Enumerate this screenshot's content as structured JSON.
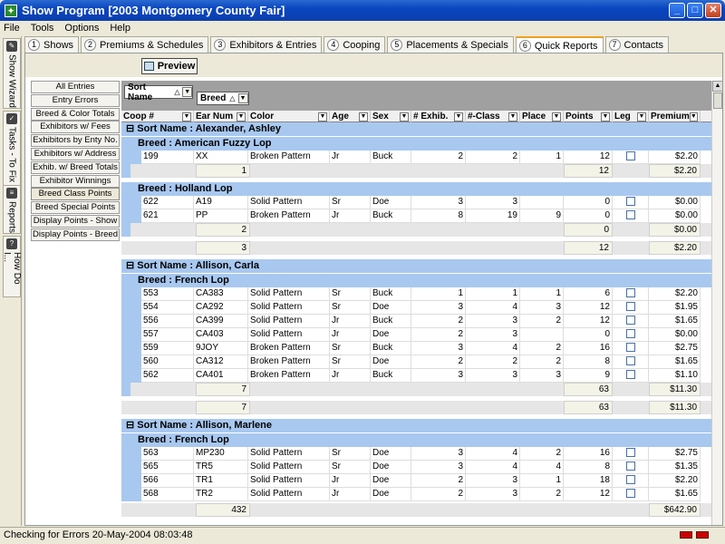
{
  "window": {
    "title": "Show Program [2003 Montgomery County Fair]"
  },
  "menu": [
    "File",
    "Tools",
    "Options",
    "Help"
  ],
  "side_tabs": [
    "Show Wizard",
    "Tasks - To Fix",
    "Reports",
    "How Do I..."
  ],
  "tabs": [
    {
      "num": "1",
      "label": "Shows"
    },
    {
      "num": "2",
      "label": "Premiums & Schedules"
    },
    {
      "num": "3",
      "label": "Exhibitors & Entries"
    },
    {
      "num": "4",
      "label": "Cooping"
    },
    {
      "num": "5",
      "label": "Placements & Specials"
    },
    {
      "num": "6",
      "label": "Quick Reports"
    },
    {
      "num": "7",
      "label": "Contacts"
    }
  ],
  "toolbar": {
    "preview_label": "Preview"
  },
  "reports": [
    "All Entries",
    "Entry Errors",
    "Breed & Color Totals",
    "Exhibitors w/ Fees",
    "Exhibitors by Enty No.",
    "Exhibitors w/ Address",
    "Exhib. w/ Breed Totals",
    "Exhibitor Winnings",
    "Breed Class Points",
    "Breed Special Points",
    "Display Points - Show",
    "Display Points - Breed"
  ],
  "grouping": {
    "sort_name": "Sort Name",
    "breed": "Breed"
  },
  "columns": [
    "Coop #",
    "Ear Num",
    "Color",
    "Age",
    "Sex",
    "# Exhib.",
    "#-Class",
    "Place",
    "Points",
    "Leg",
    "Premium"
  ],
  "groups": [
    {
      "name": "Sort Name : Alexander, Ashley",
      "breeds": [
        {
          "name": "Breed : American Fuzzy Lop",
          "rows": [
            [
              "199",
              "XX",
              "Broken Pattern",
              "Jr",
              "Buck",
              "2",
              "2",
              "1",
              "12",
              "",
              "$2.20"
            ]
          ],
          "sum": {
            "count": "1",
            "points": "12",
            "premium": "$2.20"
          }
        },
        {
          "name": "Breed : Holland Lop",
          "rows": [
            [
              "622",
              "A19",
              "Solid Pattern",
              "Sr",
              "Doe",
              "3",
              "3",
              "",
              "0",
              "",
              "$0.00"
            ],
            [
              "621",
              "PP",
              "Broken Pattern",
              "Jr",
              "Buck",
              "8",
              "19",
              "9",
              "0",
              "",
              "$0.00"
            ]
          ],
          "sum": {
            "count": "2",
            "points": "0",
            "premium": "$0.00"
          }
        }
      ],
      "sum": {
        "count": "3",
        "points": "12",
        "premium": "$2.20"
      }
    },
    {
      "name": "Sort Name : Allison, Carla",
      "breeds": [
        {
          "name": "Breed : French Lop",
          "rows": [
            [
              "553",
              "CA383",
              "Solid Pattern",
              "Sr",
              "Buck",
              "1",
              "1",
              "1",
              "6",
              "",
              "$2.20"
            ],
            [
              "554",
              "CA292",
              "Solid Pattern",
              "Sr",
              "Doe",
              "3",
              "4",
              "3",
              "12",
              "",
              "$1.95"
            ],
            [
              "556",
              "CA399",
              "Solid Pattern",
              "Jr",
              "Buck",
              "2",
              "3",
              "2",
              "12",
              "",
              "$1.65"
            ],
            [
              "557",
              "CA403",
              "Solid Pattern",
              "Jr",
              "Doe",
              "2",
              "3",
              "",
              "0",
              "",
              "$0.00"
            ],
            [
              "559",
              "9JOY",
              "Broken Pattern",
              "Sr",
              "Buck",
              "3",
              "4",
              "2",
              "16",
              "",
              "$2.75"
            ],
            [
              "560",
              "CA312",
              "Broken Pattern",
              "Sr",
              "Doe",
              "2",
              "2",
              "2",
              "8",
              "",
              "$1.65"
            ],
            [
              "562",
              "CA401",
              "Broken Pattern",
              "Jr",
              "Buck",
              "3",
              "3",
              "3",
              "9",
              "",
              "$1.10"
            ]
          ],
          "sum": {
            "count": "7",
            "points": "63",
            "premium": "$11.30"
          }
        }
      ],
      "sum": {
        "count": "7",
        "points": "63",
        "premium": "$11.30"
      }
    },
    {
      "name": "Sort Name : Allison, Marlene",
      "breeds": [
        {
          "name": "Breed : French Lop",
          "rows": [
            [
              "563",
              "MP230",
              "Solid Pattern",
              "Sr",
              "Doe",
              "3",
              "4",
              "2",
              "16",
              "",
              "$2.75"
            ],
            [
              "565",
              "TR5",
              "Solid Pattern",
              "Sr",
              "Doe",
              "3",
              "4",
              "4",
              "8",
              "",
              "$1.35"
            ],
            [
              "566",
              "TR1",
              "Solid Pattern",
              "Jr",
              "Doe",
              "2",
              "3",
              "1",
              "18",
              "",
              "$2.20"
            ],
            [
              "568",
              "TR2",
              "Solid Pattern",
              "Jr",
              "Doe",
              "2",
              "3",
              "2",
              "12",
              "",
              "$1.65"
            ]
          ]
        }
      ]
    }
  ],
  "footer": {
    "count": "432",
    "premium": "$642.90"
  },
  "status": {
    "text": "Checking for Errors 20-May-2004 08:03:48"
  }
}
